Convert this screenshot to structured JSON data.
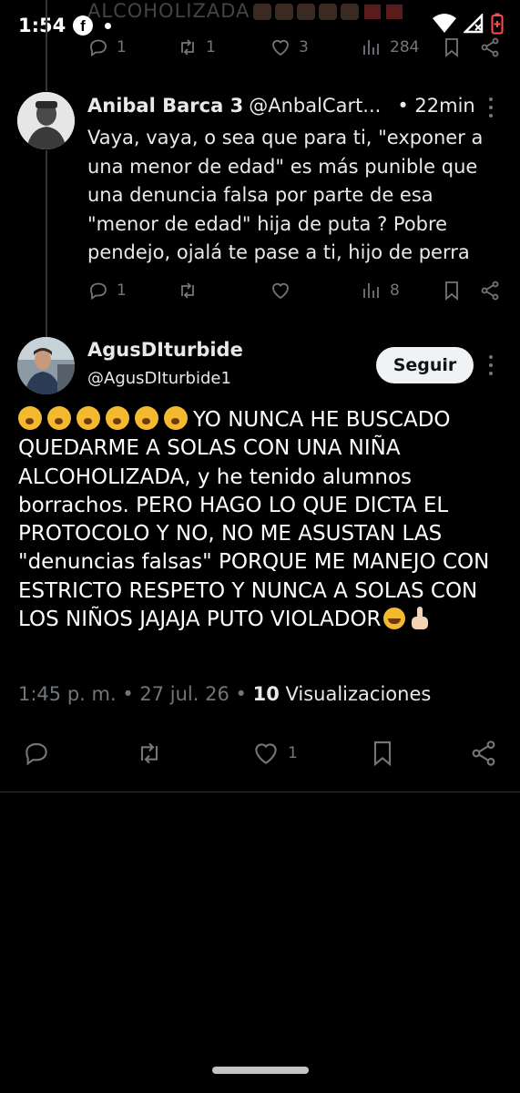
{
  "status_bar": {
    "time": "1:54",
    "app_icon": "facebook-icon",
    "notification_dot": "dot-icon",
    "icons": [
      "wifi-icon",
      "no-signal-icon",
      "battery-low-icon"
    ]
  },
  "top_tweet": {
    "ghost_text": "ALCOHOLIZADA",
    "replies": "1",
    "retweets": "1",
    "likes": "3",
    "views": "284"
  },
  "reply": {
    "name": "Anibal Barca 3",
    "handle": "@AnbalCart...",
    "time": "• 22min",
    "text": "Vaya, vaya, o sea que para ti, \"exponer a una menor de edad\" es más punible que una denuncia falsa por parte de esa \"menor de edad\" hija de puta ? Pobre pendejo, ojalá te pase a ti, hijo de perra",
    "replies": "1",
    "views": "8"
  },
  "main_tweet": {
    "name": "AgusDIturbide",
    "handle": "@AgusDIturbide1",
    "follow_label": "Seguir",
    "text": "YO NUNCA HE BUSCADO QUEDARME A SOLAS CON UNA NIÑA ALCOHOLIZADA, y he tenido alumnos borrachos. PERO HAGO LO QUE DICTA EL PROTOCOLO Y NO, NO ME ASUSTAN LAS \"denuncias falsas\" PORQUE ME MANEJO CON ESTRICTO RESPETO Y NUNCA A SOLAS CON LOS NIÑOS JAJAJA PUTO VIOLADOR",
    "meta_time": "1:45 p. m. • 27 jul. 26 • ",
    "views_count": "10",
    "views_label": " Visualizaciones",
    "likes": "1"
  }
}
